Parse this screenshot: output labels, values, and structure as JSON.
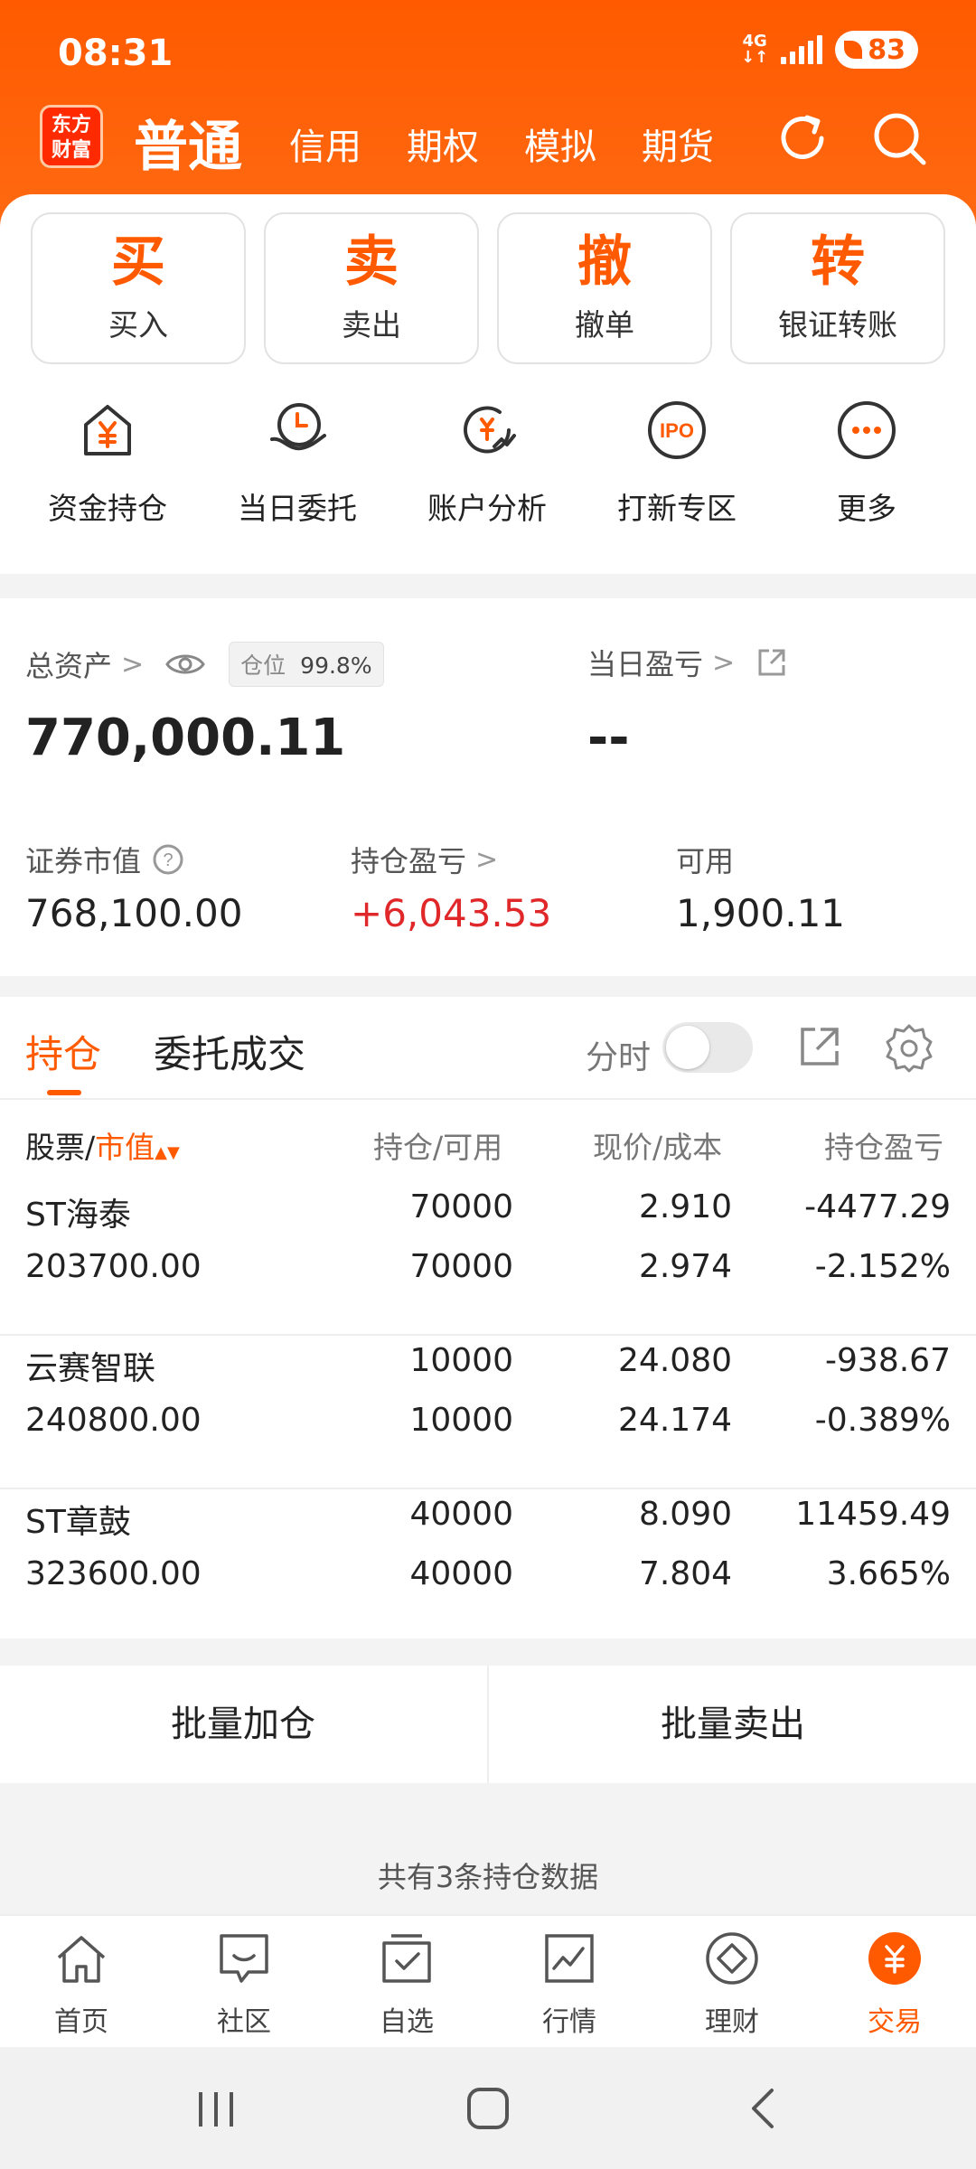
{
  "status_bar": {
    "time": "08:31",
    "network": "4G",
    "battery": "83"
  },
  "header": {
    "logo_line1": "东方",
    "logo_line2": "财富",
    "tabs": [
      "普通",
      "信用",
      "期权",
      "模拟",
      "期货"
    ],
    "active_tab": "普通"
  },
  "actions": [
    {
      "big": "买",
      "label": "买入"
    },
    {
      "big": "卖",
      "label": "卖出"
    },
    {
      "big": "撤",
      "label": "撤单"
    },
    {
      "big": "转",
      "label": "银证转账"
    }
  ],
  "features": [
    {
      "label": "资金持仓",
      "icon": "yuan-house-icon"
    },
    {
      "label": "当日委托",
      "icon": "hand-clock-icon"
    },
    {
      "label": "账户分析",
      "icon": "yuan-chart-icon"
    },
    {
      "label": "打新专区",
      "icon": "ipo-icon"
    },
    {
      "label": "更多",
      "icon": "more-dots-icon"
    }
  ],
  "assets": {
    "total_label": "总资产",
    "position_chip_label": "仓位",
    "position_pct": "99.8%",
    "total_value": "770,000.11",
    "daily_pnl_label": "当日盈亏",
    "daily_pnl_value": "--",
    "market_value_label": "证券市值",
    "market_value": "768,100.00",
    "holding_pnl_label": "持仓盈亏",
    "holding_pnl": "+6,043.53",
    "available_label": "可用",
    "available": "1,900.11"
  },
  "holdings": {
    "tab_positions": "持仓",
    "tab_orders": "委托成交",
    "intraday_label": "分时",
    "col_stock_a": "股票/",
    "col_stock_b": "市值",
    "col_qty": "持仓/可用",
    "col_price": "现价/成本",
    "col_pnl": "持仓盈亏",
    "rows": [
      {
        "name": "ST海泰",
        "value": "203700.00",
        "qty": "70000",
        "avail": "70000",
        "price": "2.910",
        "cost": "2.974",
        "pnl": "-4477.29",
        "pnl_pct": "-2.152%",
        "trend": "down"
      },
      {
        "name": "云赛智联",
        "value": "240800.00",
        "qty": "10000",
        "avail": "10000",
        "price": "24.080",
        "cost": "24.174",
        "pnl": "-938.67",
        "pnl_pct": "-0.389%",
        "trend": "down"
      },
      {
        "name": "ST章鼓",
        "value": "323600.00",
        "qty": "40000",
        "avail": "40000",
        "price": "8.090",
        "cost": "7.804",
        "pnl": "11459.49",
        "pnl_pct": "3.665%",
        "trend": "up"
      }
    ]
  },
  "batch": {
    "add": "批量加仓",
    "sell": "批量卖出"
  },
  "count_text": "共有3条持仓数据",
  "bottom_nav": [
    {
      "label": "首页"
    },
    {
      "label": "社区"
    },
    {
      "label": "自选"
    },
    {
      "label": "行情"
    },
    {
      "label": "理财"
    },
    {
      "label": "交易"
    }
  ],
  "colors": {
    "brand": "#ff5a00",
    "loss": "#1a9b2a",
    "gain": "#e0282a"
  }
}
